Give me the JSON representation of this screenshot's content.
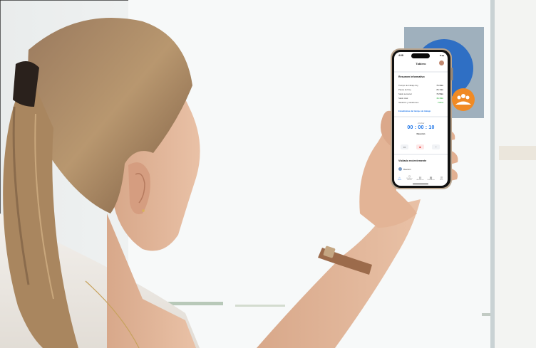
{
  "phone": {
    "status_time": "4:08",
    "status_icons": "▾ ▬",
    "title": "Tablero",
    "summary": {
      "heading": "Resumen informativo",
      "rows": [
        {
          "label": "Tiempo de trabajo hoy",
          "value": "7h 30m",
          "tone": "normal"
        },
        {
          "label": "Pausa del hoy",
          "value": "2h 14m",
          "tone": "normal"
        },
        {
          "label": "Saldo semanal",
          "value": "7h 58m",
          "tone": "normal"
        },
        {
          "label": "Saldo total",
          "value": "4h 40m",
          "tone": "green"
        },
        {
          "label": "Vacación y vacaciones",
          "value": "7.00 d",
          "tone": "green"
        }
      ],
      "link": "Estadísticas del tiempo de trabajo"
    },
    "clock": {
      "status": "• Fichar",
      "timer": "00 : 00 : 10",
      "label": "Reunión"
    },
    "actions": [
      "▭",
      "■",
      "◔"
    ],
    "recent": {
      "heading": "Visitado recientemente",
      "item": "Reunión"
    },
    "tabs": [
      {
        "icon": "⌂",
        "label": "Inicio",
        "active": true
      },
      {
        "icon": "◷",
        "label": "Registro horario",
        "active": false
      },
      {
        "icon": "▤",
        "label": "Ausencias",
        "active": false
      },
      {
        "icon": "▦",
        "label": "Calendario",
        "active": false
      },
      {
        "icon": "☰",
        "label": "Más",
        "active": false
      }
    ]
  },
  "colors": {
    "accent_blue": "#1a73e8",
    "positive_green": "#39b54a",
    "poster_blue": "#2f6fc4",
    "poster_orange": "#f08a24"
  }
}
